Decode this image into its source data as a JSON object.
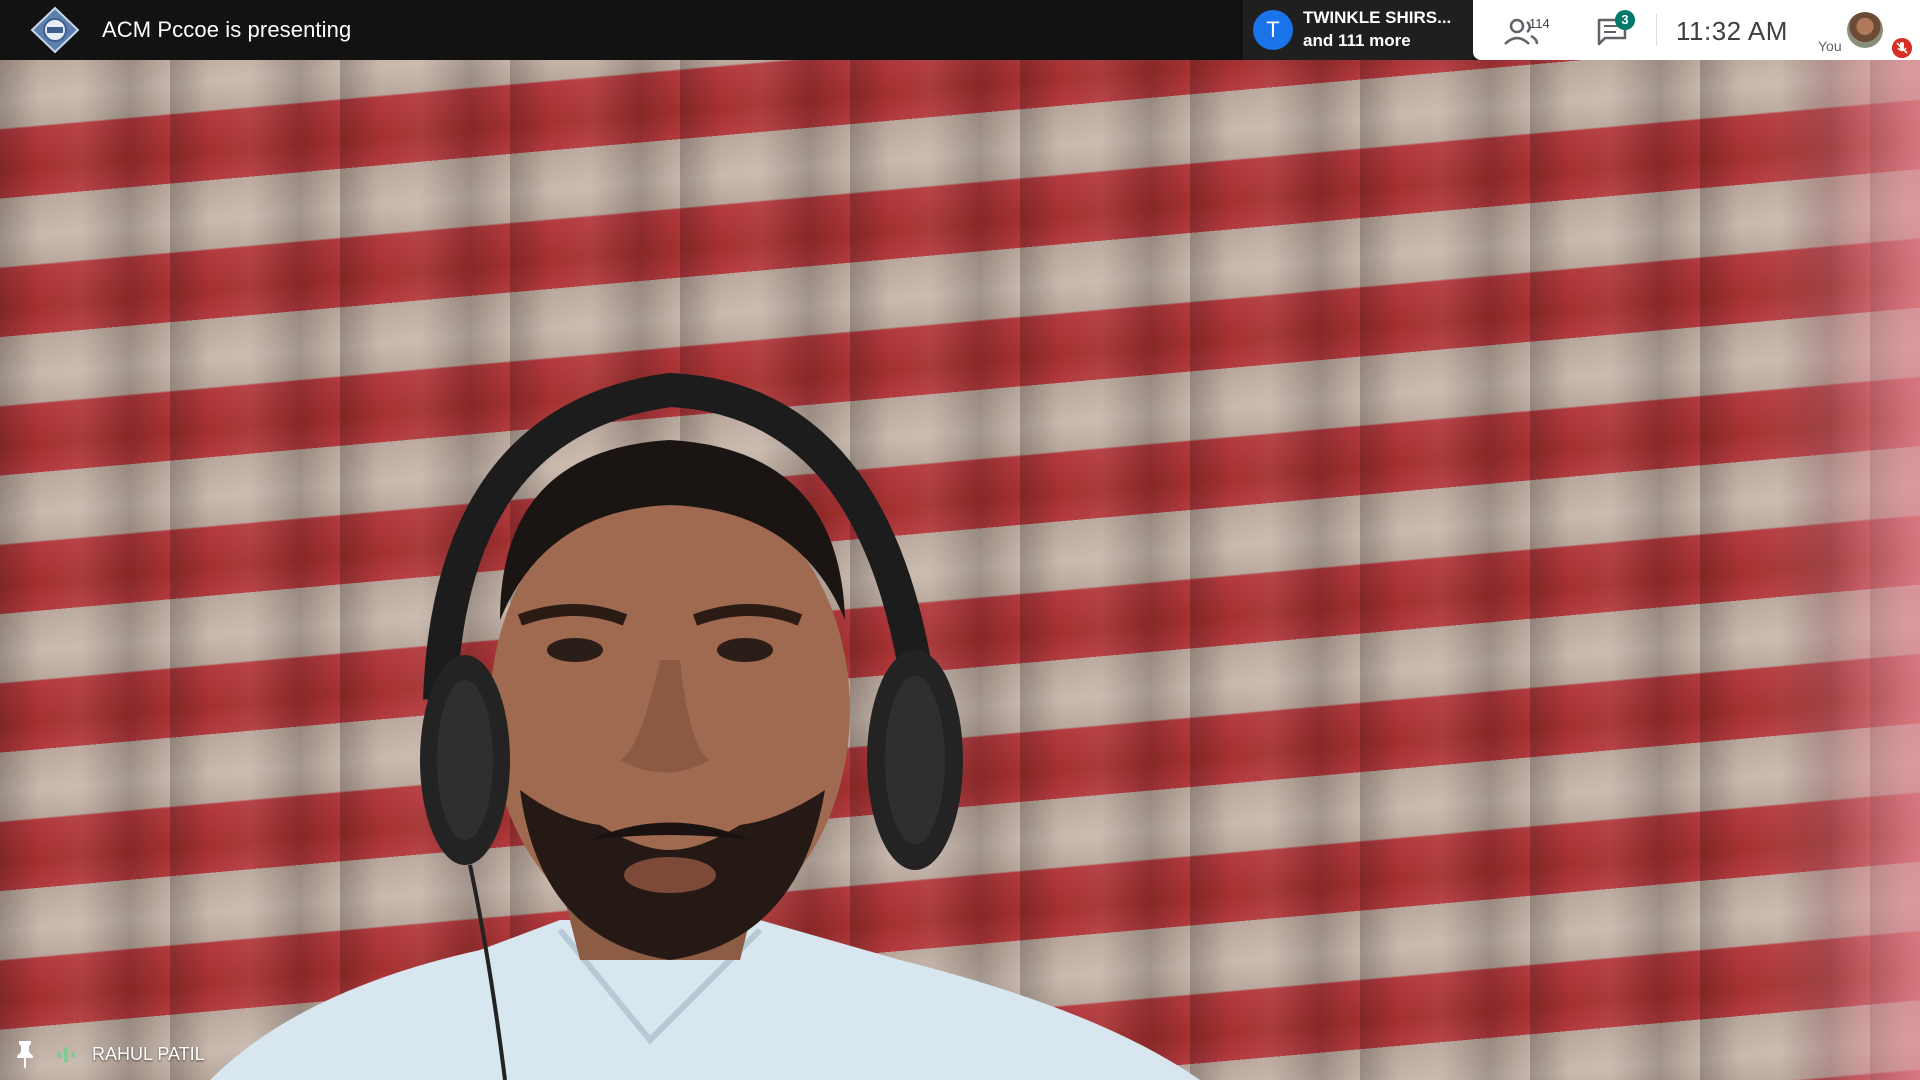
{
  "meeting": {
    "presenting_text": "ACM Pccoe is presenting",
    "logo_icon": "acm-diamond-logo"
  },
  "speakers": {
    "avatar_letter": "T",
    "avatar_color": "#1a73e8",
    "name": "TWINKLE SHIRS...",
    "more": "and 111 more"
  },
  "toolbar": {
    "people_count": "114",
    "chat_badge": "3",
    "chat_badge_color": "#00796b",
    "clock": "11:32  AM",
    "self_label": "You",
    "mic_off_color": "#d93025"
  },
  "tile": {
    "participant_name": "RAHUL PATIL",
    "audio_indicator_color": "#81c995"
  },
  "colors": {
    "curtain_red": "#b43a3f",
    "curtain_beige": "#c8b8ad",
    "topbar": "#121212"
  }
}
